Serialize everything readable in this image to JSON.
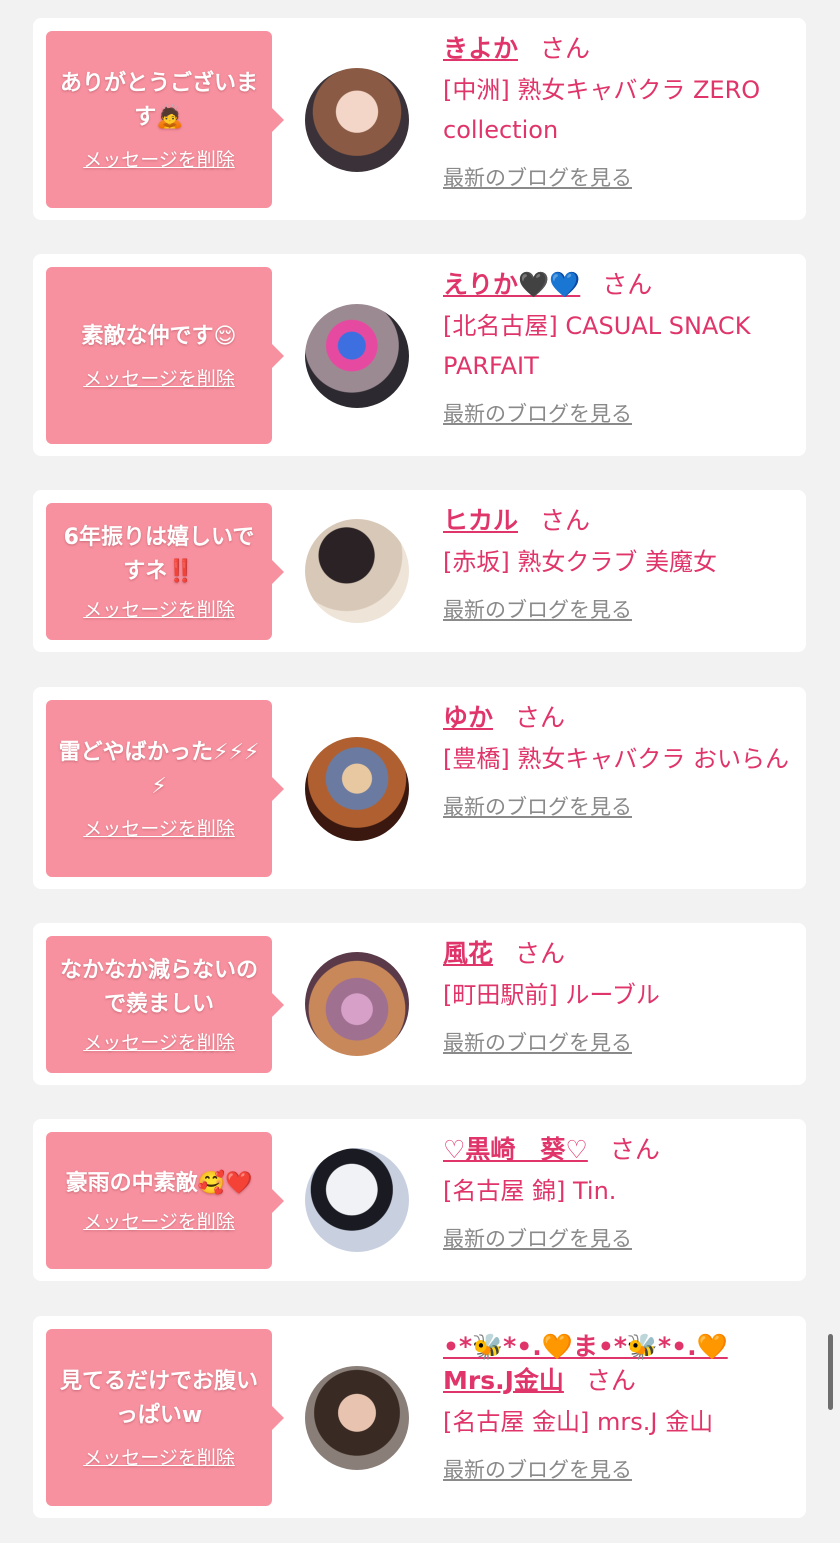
{
  "delete_label": "メッセージを削除",
  "blog_label": "最新のブログを見る",
  "san_label": "さん",
  "items": [
    {
      "message": "ありがとうございます🙇",
      "name": "きよか",
      "shop": "[中洲] 熟女キャバクラ ZERO collection"
    },
    {
      "message": "素敵な仲です😌",
      "name": "えりか🖤💙",
      "shop": "[北名古屋] CASUAL SNACK PARFAIT"
    },
    {
      "message": "6年振りは嬉しいですネ‼️",
      "name": "ヒカル",
      "shop": "[赤坂] 熟女クラブ 美魔女"
    },
    {
      "message": "雷どやばかった⚡⚡⚡⚡",
      "name": "ゆか",
      "shop": "[豊橋] 熟女キャバクラ おいらん"
    },
    {
      "message": "なかなか減らないので羨ましい",
      "name": "風花",
      "shop": "[町田駅前] ルーブル"
    },
    {
      "message": "豪雨の中素敵🥰❤️",
      "name": "♡黒崎　葵♡",
      "shop": "[名古屋 錦] Tin."
    },
    {
      "message": "見てるだけでお腹いっぱいw",
      "name": "•*🐝*•.🧡ま•*🐝*•.🧡Mrs.J金山",
      "shop": "[名古屋 金山] mrs.J 金山"
    }
  ],
  "colors": {
    "background": "#f2f2f2",
    "bubble": "#f7919f",
    "accent": "#e0356a",
    "muted": "#8a8a8a"
  }
}
